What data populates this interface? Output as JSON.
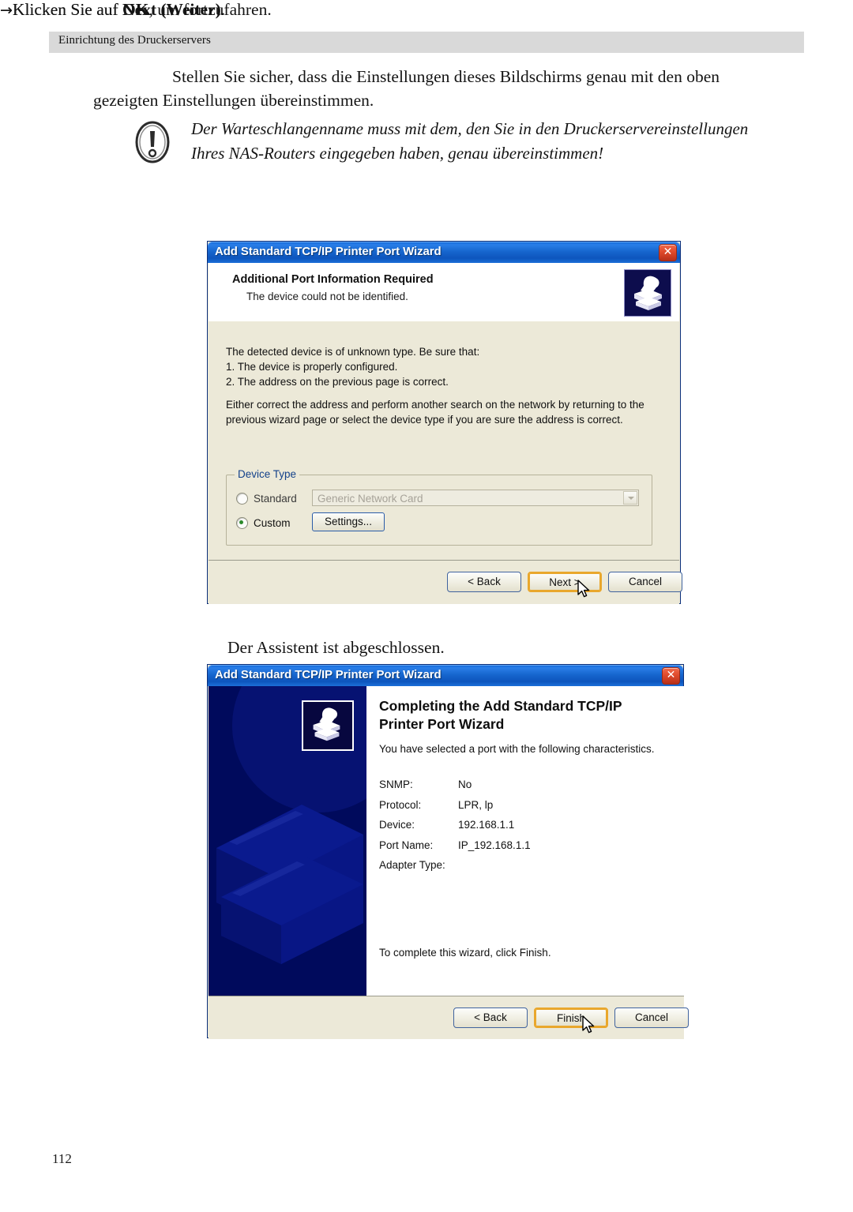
{
  "page": {
    "header": "Einrichtung des Druckerservers",
    "number": "112"
  },
  "content": {
    "intro": "Stellen Sie sicher, dass die Einstellungen dieses Bildschirms genau mit den oben gezeigten Einstellungen übereinstimmen.",
    "note": "Der Warteschlangenname muss mit dem, den Sie in den Druckerservereinstellungen Ihres NAS-Routers eingegeben haben, genau übereinstimmen!",
    "note_icon": "exclamation-oval-icon",
    "step_ok_prefix": "Klicken Sie auf ",
    "step_ok_bold": "OK",
    "step_ok_suffix": ", um fortzufahren.",
    "step_next_prefix": "Klicken Sie auf ",
    "step_next_bold": "Next (Weiter)",
    "step_next_suffix": ".",
    "wizard_done": "Der Assistent ist abgeschlossen.",
    "arrow": "→"
  },
  "dialog1": {
    "title": "Add Standard TCP/IP Printer Port Wizard",
    "close_label": "✕",
    "head_title": "Additional Port Information Required",
    "head_sub": "The device could not be identified.",
    "icon": "printer-hand-icon",
    "body_paragraph1": "The detected device is of unknown type.  Be sure that:\n1. The device is properly configured.\n2.  The address on the previous page is correct.",
    "body_paragraph2": "Either correct the address and perform another search on the network by returning to the previous wizard page or select the device type if you are sure the address is correct.",
    "groupbox_label": "Device Type",
    "radio_standard_label": "Standard",
    "radio_custom_label": "Custom",
    "radio_selected": "Custom",
    "combo_value": "Generic Network Card",
    "combo_enabled": false,
    "settings_button": "Settings...",
    "buttons": {
      "back": "< Back",
      "next": "Next >",
      "cancel": "Cancel",
      "default": "Next >"
    }
  },
  "dialog2": {
    "title": "Add Standard TCP/IP Printer Port Wizard",
    "close_label": "✕",
    "heading": "Completing the Add Standard TCP/IP Printer Port Wizard",
    "subtitle": "You have selected a port with the following characteristics.",
    "icon": "printer-hand-icon",
    "watermark": "printer-watermark-graphic",
    "properties": [
      {
        "key": "SNMP:",
        "value": "No"
      },
      {
        "key": "Protocol:",
        "value": "LPR, lp"
      },
      {
        "key": "Device:",
        "value": "192.168.1.1"
      },
      {
        "key": "Port Name:",
        "value": "IP_192.168.1.1"
      },
      {
        "key": "Adapter Type:",
        "value": ""
      }
    ],
    "finish_note": "To complete this wizard, click Finish.",
    "buttons": {
      "back": "< Back",
      "finish": "Finish",
      "cancel": "Cancel",
      "default": "Finish"
    }
  },
  "colors": {
    "titlebar_blue": "#1767cf",
    "dialog_face": "#ece9d8",
    "default_button_outline": "#e9a72c",
    "close_red": "#e04a2b",
    "sidebar_navy": "#000a5c",
    "group_label_blue": "#13418a",
    "page_header_gray": "#d9d9d9"
  }
}
